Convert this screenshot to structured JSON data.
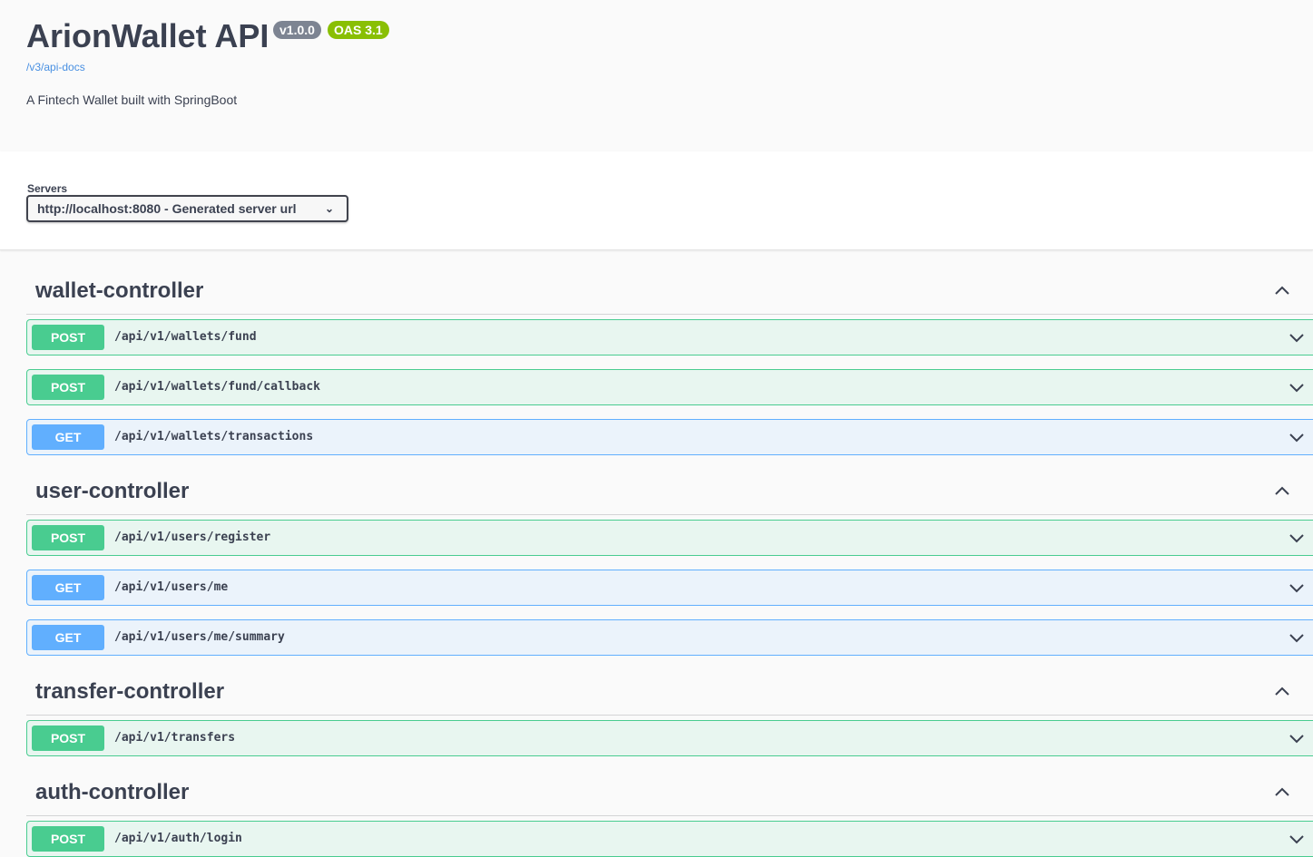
{
  "info": {
    "title": "ArionWallet API",
    "version_badge": "v1.0.0",
    "oas_badge": "OAS 3.1",
    "spec_link": "/v3/api-docs",
    "description": "A Fintech Wallet built with SpringBoot"
  },
  "servers": {
    "label": "Servers",
    "selected": "http://localhost:8080 - Generated server url"
  },
  "colors": {
    "post": "#49cc90",
    "get": "#61affe"
  },
  "tags": [
    {
      "name": "wallet-controller",
      "ops": [
        {
          "method": "POST",
          "path": "/api/v1/wallets/fund"
        },
        {
          "method": "POST",
          "path": "/api/v1/wallets/fund/callback"
        },
        {
          "method": "GET",
          "path": "/api/v1/wallets/transactions"
        }
      ]
    },
    {
      "name": "user-controller",
      "ops": [
        {
          "method": "POST",
          "path": "/api/v1/users/register"
        },
        {
          "method": "GET",
          "path": "/api/v1/users/me"
        },
        {
          "method": "GET",
          "path": "/api/v1/users/me/summary"
        }
      ]
    },
    {
      "name": "transfer-controller",
      "ops": [
        {
          "method": "POST",
          "path": "/api/v1/transfers"
        }
      ]
    },
    {
      "name": "auth-controller",
      "ops": [
        {
          "method": "POST",
          "path": "/api/v1/auth/login"
        }
      ]
    }
  ]
}
